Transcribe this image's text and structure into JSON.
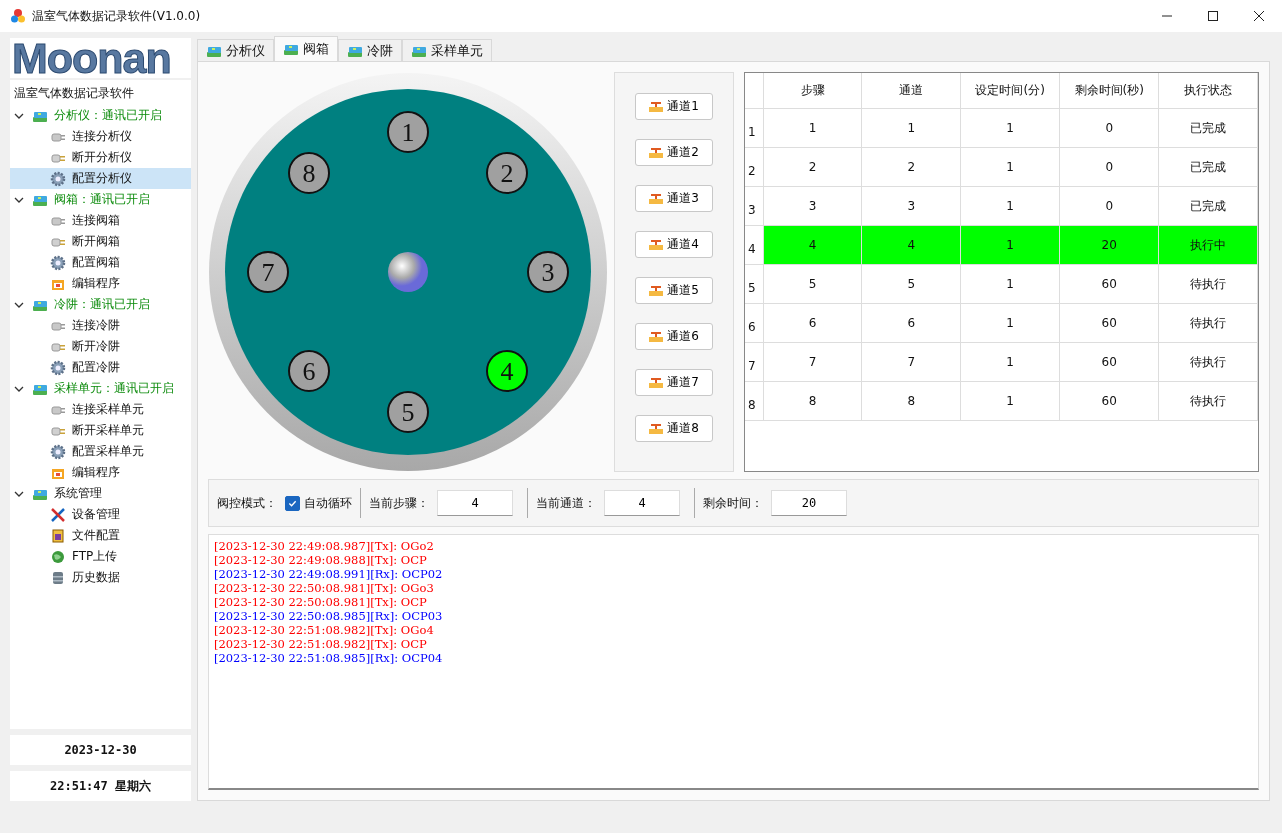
{
  "window": {
    "title": "温室气体数据记录软件(V1.0.0)"
  },
  "sidebar": {
    "logo": "Moonan",
    "tree_title": "温室气体数据记录软件",
    "tree": [
      {
        "label": "分析仪：通讯已开启",
        "kind": "group",
        "connected": true,
        "expanded": true,
        "selected": false,
        "children": [
          {
            "label": "连接分析仪",
            "kind": "connect",
            "selected": false
          },
          {
            "label": "断开分析仪",
            "kind": "disconnect",
            "selected": false
          },
          {
            "label": "配置分析仪",
            "kind": "config",
            "selected": true
          }
        ]
      },
      {
        "label": "阀箱：通讯已开启",
        "kind": "group",
        "connected": true,
        "expanded": true,
        "selected": false,
        "children": [
          {
            "label": "连接阀箱",
            "kind": "connect",
            "selected": false
          },
          {
            "label": "断开阀箱",
            "kind": "disconnect",
            "selected": false
          },
          {
            "label": "配置阀箱",
            "kind": "config",
            "selected": false
          },
          {
            "label": "编辑程序",
            "kind": "program",
            "selected": false
          }
        ]
      },
      {
        "label": "冷阱：通讯已开启",
        "kind": "group",
        "connected": true,
        "expanded": true,
        "selected": false,
        "children": [
          {
            "label": "连接冷阱",
            "kind": "connect",
            "selected": false
          },
          {
            "label": "断开冷阱",
            "kind": "disconnect",
            "selected": false
          },
          {
            "label": "配置冷阱",
            "kind": "config",
            "selected": false
          }
        ]
      },
      {
        "label": "采样单元：通讯已开启",
        "kind": "group",
        "connected": true,
        "expanded": true,
        "selected": false,
        "children": [
          {
            "label": "连接采样单元",
            "kind": "connect",
            "selected": false
          },
          {
            "label": "断开采样单元",
            "kind": "disconnect",
            "selected": false
          },
          {
            "label": "配置采样单元",
            "kind": "config",
            "selected": false
          },
          {
            "label": "编辑程序",
            "kind": "program",
            "selected": false
          }
        ]
      },
      {
        "label": "系统管理",
        "kind": "group",
        "connected": false,
        "expanded": true,
        "selected": false,
        "children": [
          {
            "label": "设备管理",
            "kind": "tools",
            "selected": false
          },
          {
            "label": "文件配置",
            "kind": "file",
            "selected": false
          },
          {
            "label": "FTP上传",
            "kind": "ftp",
            "selected": false
          },
          {
            "label": "历史数据",
            "kind": "database",
            "selected": false
          }
        ]
      }
    ],
    "date": "2023-12-30",
    "time": "22:51:47 星期六"
  },
  "tabs": [
    {
      "label": "分析仪",
      "selected": false
    },
    {
      "label": "阀箱",
      "selected": true
    },
    {
      "label": "冷阱",
      "selected": false
    },
    {
      "label": "采样单元",
      "selected": false
    }
  ],
  "dial": {
    "channels": [
      {
        "label": "1",
        "active": false
      },
      {
        "label": "2",
        "active": false
      },
      {
        "label": "3",
        "active": false
      },
      {
        "label": "4",
        "active": true
      },
      {
        "label": "5",
        "active": false
      },
      {
        "label": "6",
        "active": false
      },
      {
        "label": "7",
        "active": false
      },
      {
        "label": "8",
        "active": false
      }
    ]
  },
  "channel_buttons": [
    "通道1",
    "通道2",
    "通道3",
    "通道4",
    "通道5",
    "通道6",
    "通道7",
    "通道8"
  ],
  "table": {
    "columns": [
      "步骤",
      "通道",
      "设定时间(分)",
      "剩余时间(秒)",
      "执行状态"
    ],
    "rows": [
      {
        "index": "1",
        "cells": [
          "1",
          "1",
          "1",
          "0",
          "已完成"
        ],
        "running": false
      },
      {
        "index": "2",
        "cells": [
          "2",
          "2",
          "1",
          "0",
          "已完成"
        ],
        "running": false
      },
      {
        "index": "3",
        "cells": [
          "3",
          "3",
          "1",
          "0",
          "已完成"
        ],
        "running": false
      },
      {
        "index": "4",
        "cells": [
          "4",
          "4",
          "1",
          "20",
          "执行中"
        ],
        "running": true
      },
      {
        "index": "5",
        "cells": [
          "5",
          "5",
          "1",
          "60",
          "待执行"
        ],
        "running": false
      },
      {
        "index": "6",
        "cells": [
          "6",
          "6",
          "1",
          "60",
          "待执行"
        ],
        "running": false
      },
      {
        "index": "7",
        "cells": [
          "7",
          "7",
          "1",
          "60",
          "待执行"
        ],
        "running": false
      },
      {
        "index": "8",
        "cells": [
          "8",
          "8",
          "1",
          "60",
          "待执行"
        ],
        "running": false
      }
    ]
  },
  "controls": {
    "mode_label": "阀控模式：",
    "auto_cycle": {
      "label": "自动循环",
      "checked": true
    },
    "fields": [
      {
        "label": "当前步骤：",
        "value": "4"
      },
      {
        "label": "当前通道：",
        "value": "4"
      },
      {
        "label": "剩余时间：",
        "value": "20"
      }
    ]
  },
  "log": [
    {
      "text": "[2023-12-30 22:49:08.987][Tx]: OGo2",
      "color": "#ff0000"
    },
    {
      "text": "[2023-12-30 22:49:08.988][Tx]: OCP",
      "color": "#ff0000"
    },
    {
      "text": "[2023-12-30 22:49:08.991][Rx]: OCP02",
      "color": "#0000ff"
    },
    {
      "text": "[2023-12-30 22:50:08.981][Tx]: OGo3",
      "color": "#ff0000"
    },
    {
      "text": "[2023-12-30 22:50:08.981][Tx]: OCP",
      "color": "#ff0000"
    },
    {
      "text": "[2023-12-30 22:50:08.985][Rx]: OCP03",
      "color": "#0000ff"
    },
    {
      "text": "[2023-12-30 22:51:08.982][Tx]: OGo4",
      "color": "#ff0000"
    },
    {
      "text": "[2023-12-30 22:51:08.982][Tx]: OCP",
      "color": "#ff0000"
    },
    {
      "text": "[2023-12-30 22:51:08.985][Rx]: OCP04",
      "color": "#0000ff"
    }
  ]
}
